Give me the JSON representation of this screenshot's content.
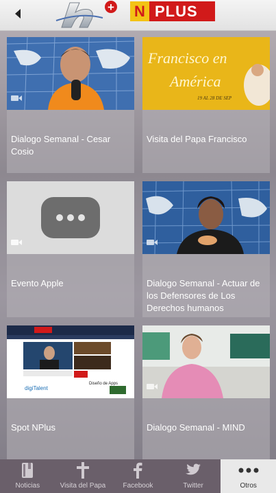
{
  "header": {
    "back_icon": "back-arrow-icon",
    "logo_h_text": "h",
    "logo_h_plus": "+",
    "logo_n": "N",
    "logo_plus": "PLUS"
  },
  "videos": [
    {
      "title": "Dialogo Semanal - Cesar Cosio",
      "thumb": "presenter-orange-shirt"
    },
    {
      "title": "Visita del Papa Francisco",
      "thumb": "francisco-en-america",
      "thumb_line1": "Francisco en",
      "thumb_line2": "América",
      "thumb_dates": "19 AL 28 DE SEP"
    },
    {
      "title": "Evento Apple",
      "thumb": "video-placeholder"
    },
    {
      "title": "Dialogo Semanal - Actuar de los Defensores de Los Derechos humanos",
      "thumb": "presenter-woman-map"
    },
    {
      "title": "Spot NPlus",
      "thumb": "website-screenshot",
      "thumb_text_1": "Diseño de Apps",
      "thumb_text_2": "digiTalent"
    },
    {
      "title": "Dialogo Semanal - MIND",
      "thumb": "woman-office"
    }
  ],
  "tabs": [
    {
      "label": "Noticias",
      "icon": "book-icon",
      "active": false
    },
    {
      "label": "Visita del Papa",
      "icon": "cross-icon",
      "active": false
    },
    {
      "label": "Facebook",
      "icon": "facebook-icon",
      "active": false
    },
    {
      "label": "Twitter",
      "icon": "twitter-icon",
      "active": false
    },
    {
      "label": "Otros",
      "icon": "more-dots-icon",
      "active": true
    }
  ],
  "colors": {
    "accent_red": "#d11a1a",
    "accent_yellow": "#f3c315",
    "tabbar": "#6a5f6a"
  }
}
